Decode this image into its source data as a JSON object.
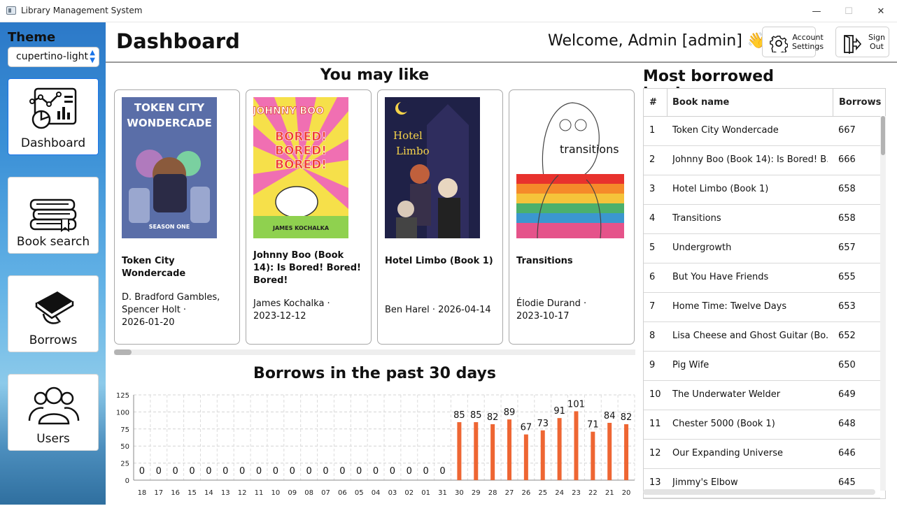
{
  "window": {
    "title": "Library Management System",
    "minimize": "—",
    "maximize": "☐",
    "close": "✕"
  },
  "sidebar": {
    "theme_label": "Theme",
    "theme_value": "cupertino-light",
    "nav": [
      {
        "label": "Dashboard",
        "icon": "dashboard-chart-icon",
        "active": true
      },
      {
        "label": "Book search",
        "icon": "books-stack-icon"
      },
      {
        "label": "Borrows",
        "icon": "hand-book-icon"
      },
      {
        "label": "Users",
        "icon": "users-icon"
      }
    ]
  },
  "header": {
    "title": "Dashboard",
    "welcome": "Welcome, Admin [admin] 👋",
    "account_settings": [
      "Account",
      "Settings"
    ],
    "sign_out": [
      "Sign",
      "Out"
    ]
  },
  "recommend": {
    "title": "You may like",
    "books": [
      {
        "title": "Token City Wondercade",
        "meta": [
          "D. Bradford Gambles,",
          "Spencer Holt ·",
          "2026-01-20"
        ],
        "cover_text": [
          "TOKEN CITY",
          "WONDERCADE",
          "SEASON ONE"
        ]
      },
      {
        "title": "Johnny Boo (Book 14): Is Bored! Bored! Bored!",
        "meta": [
          "James Kochalka ·",
          "2023-12-12"
        ],
        "cover_text": [
          "JOHNNY BOO",
          "BORED!",
          "BORED!",
          "BORED!",
          "JAMES KOCHALKA"
        ]
      },
      {
        "title": "Hotel Limbo (Book 1)",
        "meta": [
          "Ben Harel · 2026-04-14"
        ],
        "cover_text": [
          "Hotel",
          "Limbo"
        ]
      },
      {
        "title": "Transitions",
        "meta": [
          "Élodie Durand ·",
          "2023-10-17"
        ],
        "cover_text": [
          "transitions"
        ]
      }
    ]
  },
  "chart_title": "Borrows in the past 30 days",
  "chart_data": {
    "type": "bar",
    "categories": [
      "18",
      "17",
      "16",
      "15",
      "14",
      "13",
      "12",
      "11",
      "10",
      "09",
      "08",
      "07",
      "06",
      "05",
      "04",
      "03",
      "02",
      "01",
      "31",
      "30",
      "29",
      "28",
      "27",
      "26",
      "25",
      "24",
      "23",
      "22",
      "21",
      "20"
    ],
    "values": [
      0,
      0,
      0,
      0,
      0,
      0,
      0,
      0,
      0,
      0,
      0,
      0,
      0,
      0,
      0,
      0,
      0,
      0,
      0,
      85,
      85,
      82,
      89,
      67,
      73,
      91,
      101,
      71,
      84,
      82
    ],
    "ylim": [
      0,
      125
    ],
    "yticks": [
      0,
      25,
      50,
      75,
      100,
      125
    ],
    "grid": true,
    "bar_color": "#ee6633"
  },
  "most_borrowed": {
    "title": "Most borrowed books",
    "columns": [
      "#",
      "Book name",
      "Borrows"
    ],
    "rows": [
      [
        "1",
        "Token City Wondercade",
        "667"
      ],
      [
        "2",
        "Johnny Boo (Book 14): Is Bored! B...",
        "666"
      ],
      [
        "3",
        "Hotel Limbo (Book 1)",
        "658"
      ],
      [
        "4",
        "Transitions",
        "658"
      ],
      [
        "5",
        "Undergrowth",
        "657"
      ],
      [
        "6",
        "But You Have Friends",
        "655"
      ],
      [
        "7",
        "Home Time: Twelve Days",
        "653"
      ],
      [
        "8",
        "Lisa Cheese and Ghost Guitar (Bo...",
        "652"
      ],
      [
        "9",
        "Pig Wife",
        "650"
      ],
      [
        "10",
        "The Underwater Welder",
        "649"
      ],
      [
        "11",
        "Chester 5000 (Book 1)",
        "648"
      ],
      [
        "12",
        "Our Expanding Universe",
        "646"
      ],
      [
        "13",
        "Jimmy's Elbow",
        "645"
      ]
    ]
  }
}
